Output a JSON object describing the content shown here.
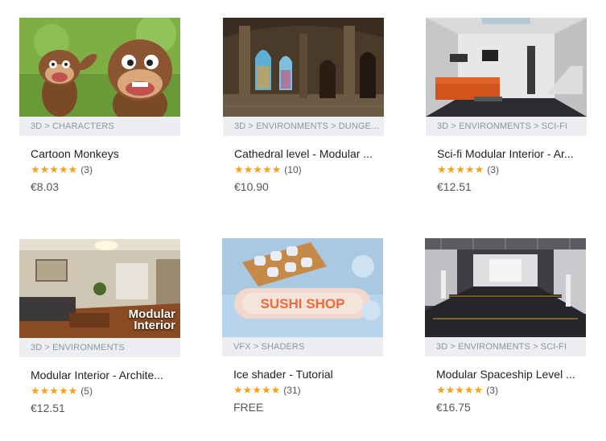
{
  "products": [
    {
      "category": "3D > CHARACTERS",
      "title": "Cartoon Monkeys",
      "stars": "★★★★★",
      "count": "(3)",
      "price": "€8.03"
    },
    {
      "category": "3D > ENVIRONMENTS > DUNGEO...",
      "title": "Cathedral level - Modular ...",
      "stars": "★★★★★",
      "count": "(10)",
      "price": "€10.90"
    },
    {
      "category": "3D > ENVIRONMENTS > SCI-FI",
      "title": "Sci-fi Modular Interior - Ar...",
      "stars": "★★★★★",
      "count": "(3)",
      "price": "€12.51"
    },
    {
      "category": "3D > ENVIRONMENTS",
      "title": "Modular Interior - Archite...",
      "stars": "★★★★★",
      "count": "(5)",
      "price": "€12.51",
      "overlay_line1": "Modular",
      "overlay_line2": "Interior"
    },
    {
      "category": "VFX > SHADERS",
      "title": "Ice shader - Tutorial",
      "stars": "★★★★★",
      "count": "(31)",
      "price": "FREE",
      "overlay": "SUSHI SHOP"
    },
    {
      "category": "3D > ENVIRONMENTS > SCI-FI",
      "title": "Modular Spaceship Level ...",
      "stars": "★★★★★",
      "count": "(3)",
      "price": "€16.75"
    }
  ],
  "colors": {
    "star": "#f7a21b",
    "category_bg": "#eceef1",
    "category_text": "#8f969d"
  }
}
